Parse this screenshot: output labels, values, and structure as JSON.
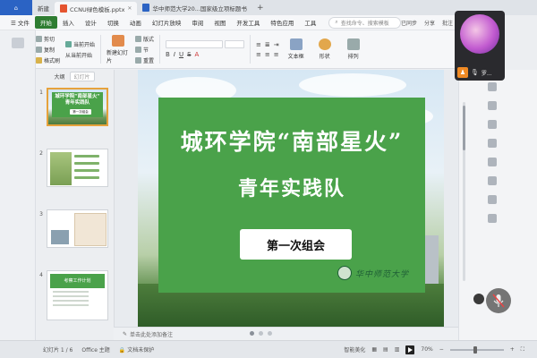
{
  "tabs": {
    "home": "",
    "new": "新建",
    "doc1": "CCNU绿色模板.pptx",
    "doc2": "华中师范大学20...国家级立项标题书",
    "plus": "+"
  },
  "menu": {
    "file": "文件",
    "items": [
      "开始",
      "插入",
      "设计",
      "切换",
      "动画",
      "幻灯片放映",
      "审阅",
      "视图",
      "开发工具",
      "特色应用",
      "工具"
    ],
    "search": "查找命令、搜索模板",
    "right": [
      "已同步",
      "分享",
      "批注"
    ]
  },
  "ribbon": {
    "paste": "粘贴",
    "cut": "剪切",
    "copy": "复制",
    "format_painter": "格式刷",
    "from_current": "当前开始",
    "from_start": "从当前开始",
    "new_slide": "新建幻灯片",
    "layout": "版式",
    "section": "节",
    "reset": "重置",
    "textbox": "文本框",
    "shape": "形状",
    "arrange": "排列"
  },
  "leftpanel": {
    "outline_tab": "大纲",
    "slide_tab": "幻灯片",
    "thumb1_title1": "城环学院“南部星火”",
    "thumb1_title2": "青年实践队",
    "thumb1_pill": "第一次组会",
    "thumb4_title": "考察工作计划"
  },
  "slide": {
    "title_line1": "城环学院“南部星火”",
    "title_line2": "青年实践队",
    "subtitle": "第一次组会",
    "logo_text": "华中师范大学"
  },
  "notes": {
    "placeholder": "单击此处添加备注"
  },
  "status": {
    "slide_counter": "幻灯片 1 / 6",
    "theme": "Office 主题",
    "protection": "文档未保护",
    "beautify": "智能美化",
    "zoom": "70%"
  },
  "call": {
    "name": "罗..."
  },
  "colors": {
    "accent_green": "#4aa24a",
    "active_tab_green": "#2e7d32",
    "home_blue": "#2b63c4",
    "call_badge": "#f08a24"
  }
}
